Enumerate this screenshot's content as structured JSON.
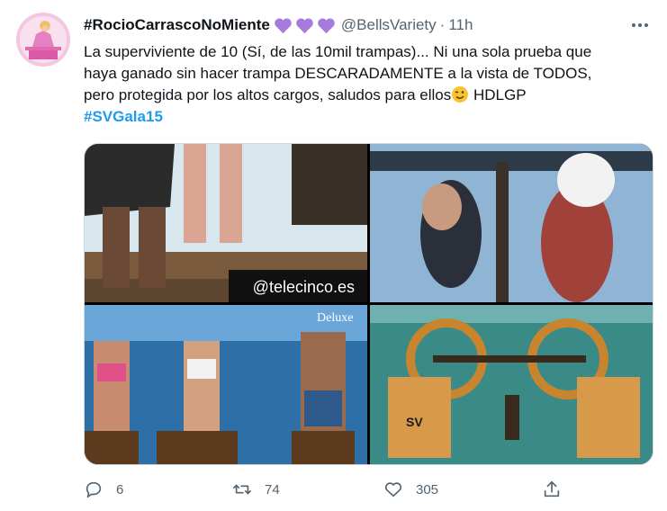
{
  "tweet": {
    "display_name": "#RocioCarrascoNoMiente",
    "name_emojis": [
      "purple-heart",
      "purple-heart",
      "purple-heart"
    ],
    "handle": "@BellsVariety",
    "separator": "·",
    "time": "11h",
    "text_line_1": "La superviviente de 10 (Sí, de las 10mil trampas)... Ni una sola prueba que",
    "text_line_2": "haya ganado sin hacer trampa DESCARADAMENTE a la vista de TODOS,",
    "text_line_3": "pero protegida por los altos cargos, saludos para ellos",
    "text_line_3_emoji": "winking-face",
    "text_line_3_end": " HDLGP",
    "hashtag": "#SVGala15",
    "media": {
      "watermark": "@telecinco.es",
      "logo_text": "Deluxe",
      "sign_text": "SV"
    },
    "actions": {
      "replies": "6",
      "retweets": "74",
      "likes": "305"
    },
    "colors": {
      "accent": "#1d9bf0",
      "secondary_text": "#536471",
      "heart": "#a77bdb"
    }
  }
}
